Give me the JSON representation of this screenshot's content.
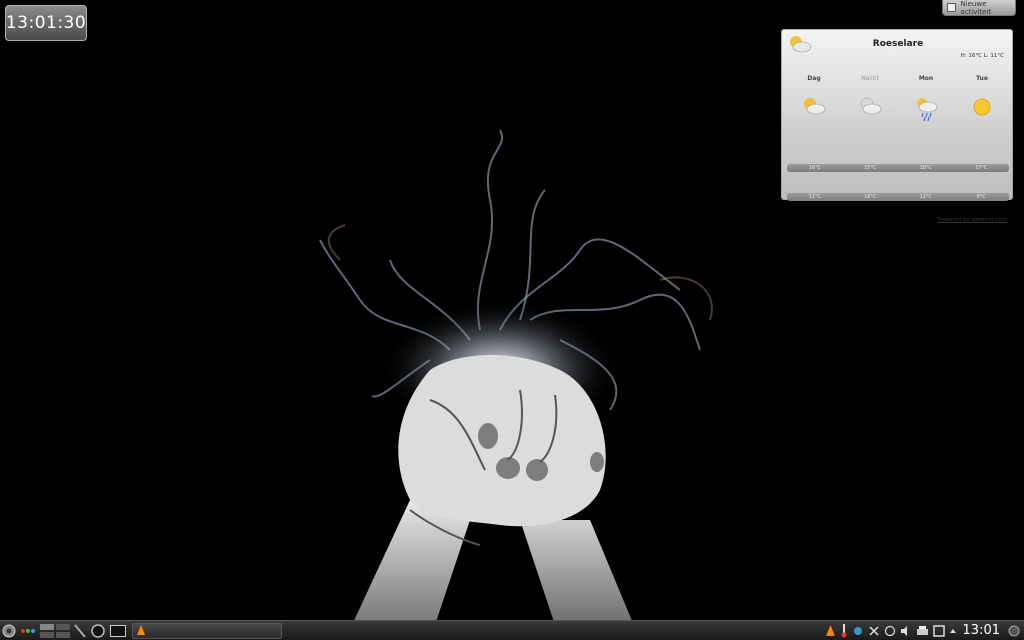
{
  "desktop": {
    "clock_widget": {
      "time": "13:01:30"
    },
    "activity_button": {
      "label": "Nieuwe activiteit"
    }
  },
  "weather": {
    "city": "Roeselare",
    "hilo": "H: 16°C L: 11°C",
    "current_icon": "partly-cloudy-icon",
    "days": [
      {
        "label": "Dag",
        "dim": false,
        "icon": "partly-cloudy-icon",
        "high": "16°C",
        "low": "11°C"
      },
      {
        "label": "Nacht",
        "dim": true,
        "icon": "cloudy-moon-icon",
        "high": "15°C",
        "low": "16°C"
      },
      {
        "label": "Mon",
        "dim": false,
        "icon": "rain-sun-icon",
        "high": "18°C",
        "low": "11°C"
      },
      {
        "label": "Tue",
        "dim": false,
        "icon": "sun-icon",
        "high": "17°C",
        "low": "8°C"
      }
    ],
    "powered_by": "Powered by weather.com"
  },
  "panel": {
    "launcher_icon": "kde-menu-icon",
    "pager_icon": "pager-icon",
    "task": {
      "icon": "vlc-icon",
      "label": ""
    },
    "tray_icons": [
      "vlc-icon",
      "thermometer-icon",
      "network-icon",
      "scissors-icon",
      "sync-icon",
      "volume-icon",
      "printer-icon",
      "notifications-icon",
      "expand-arrow-icon"
    ],
    "clock": "13:01"
  },
  "colors": {
    "panel_bg": "#2a2a2a",
    "widget_bg": "#d8d8d8"
  }
}
